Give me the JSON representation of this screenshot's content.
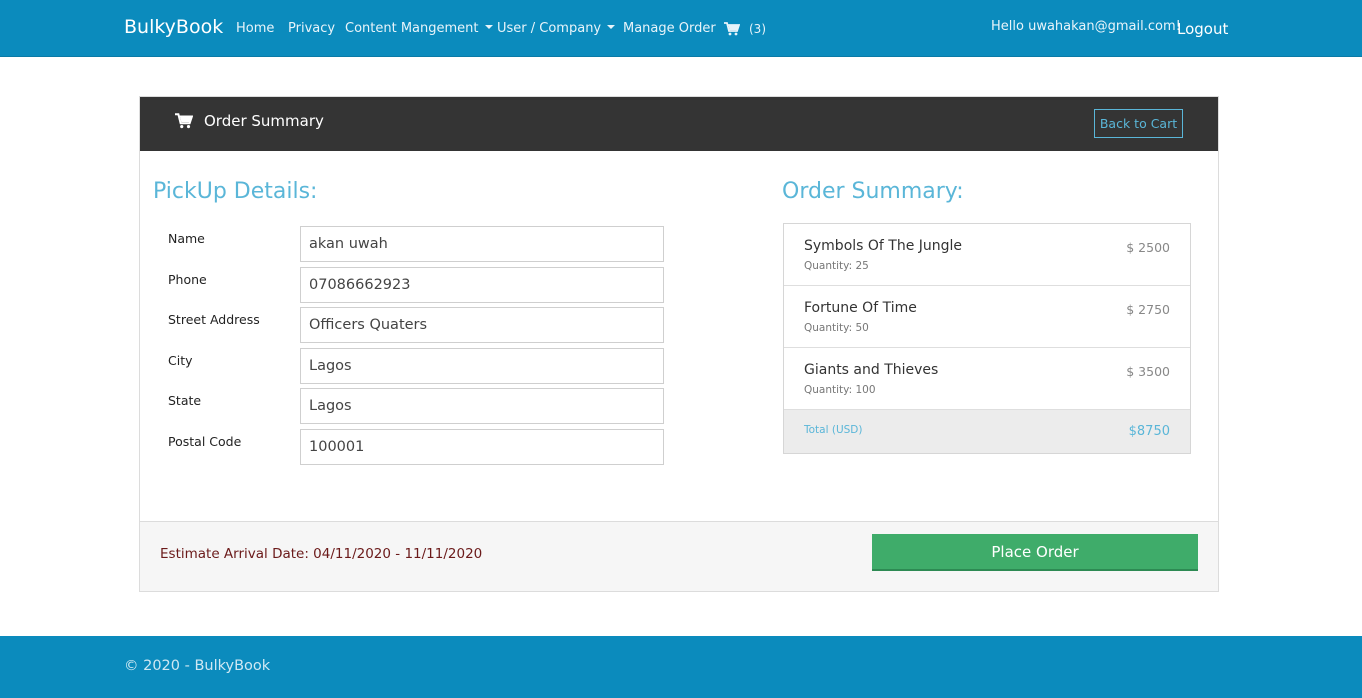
{
  "navbar": {
    "brand": "BulkyBook",
    "links": [
      "Home",
      "Privacy",
      "Content Mangement",
      "User / Company",
      "Manage Order"
    ],
    "cart_count": "(3)",
    "greeting": "Hello uwahakan@gmail.com!",
    "logout": "Logout"
  },
  "card": {
    "title": "Order Summary",
    "back_button": "Back to Cart"
  },
  "pickup": {
    "heading": "PickUp Details:",
    "fields": [
      {
        "label": "Name",
        "value": "akan uwah"
      },
      {
        "label": "Phone",
        "value": "07086662923"
      },
      {
        "label": "Street Address",
        "value": "Officers Quaters"
      },
      {
        "label": "City",
        "value": "Lagos"
      },
      {
        "label": "State",
        "value": "Lagos"
      },
      {
        "label": "Postal Code",
        "value": "100001"
      }
    ]
  },
  "summary": {
    "heading": "Order Summary:",
    "items": [
      {
        "title": "Symbols Of The Jungle",
        "quantity": "Quantity: 25",
        "price": "$ 2500"
      },
      {
        "title": "Fortune Of Time",
        "quantity": "Quantity: 50",
        "price": "$ 2750"
      },
      {
        "title": "Giants and Thieves",
        "quantity": "Quantity: 100",
        "price": "$ 3500"
      }
    ],
    "total_label": "Total (USD)",
    "total_value": "$8750"
  },
  "footer_bar": {
    "arrival": "Estimate Arrival Date: 04/11/2020 - 11/11/2020",
    "place_order": "Place Order"
  },
  "page_footer": {
    "copyright": "© 2020 - BulkyBook"
  },
  "colors": {
    "navbar": "#0b8bbd",
    "card_header": "#343434",
    "accent": "#5ab6d8",
    "place_order": "#3fac6a"
  }
}
